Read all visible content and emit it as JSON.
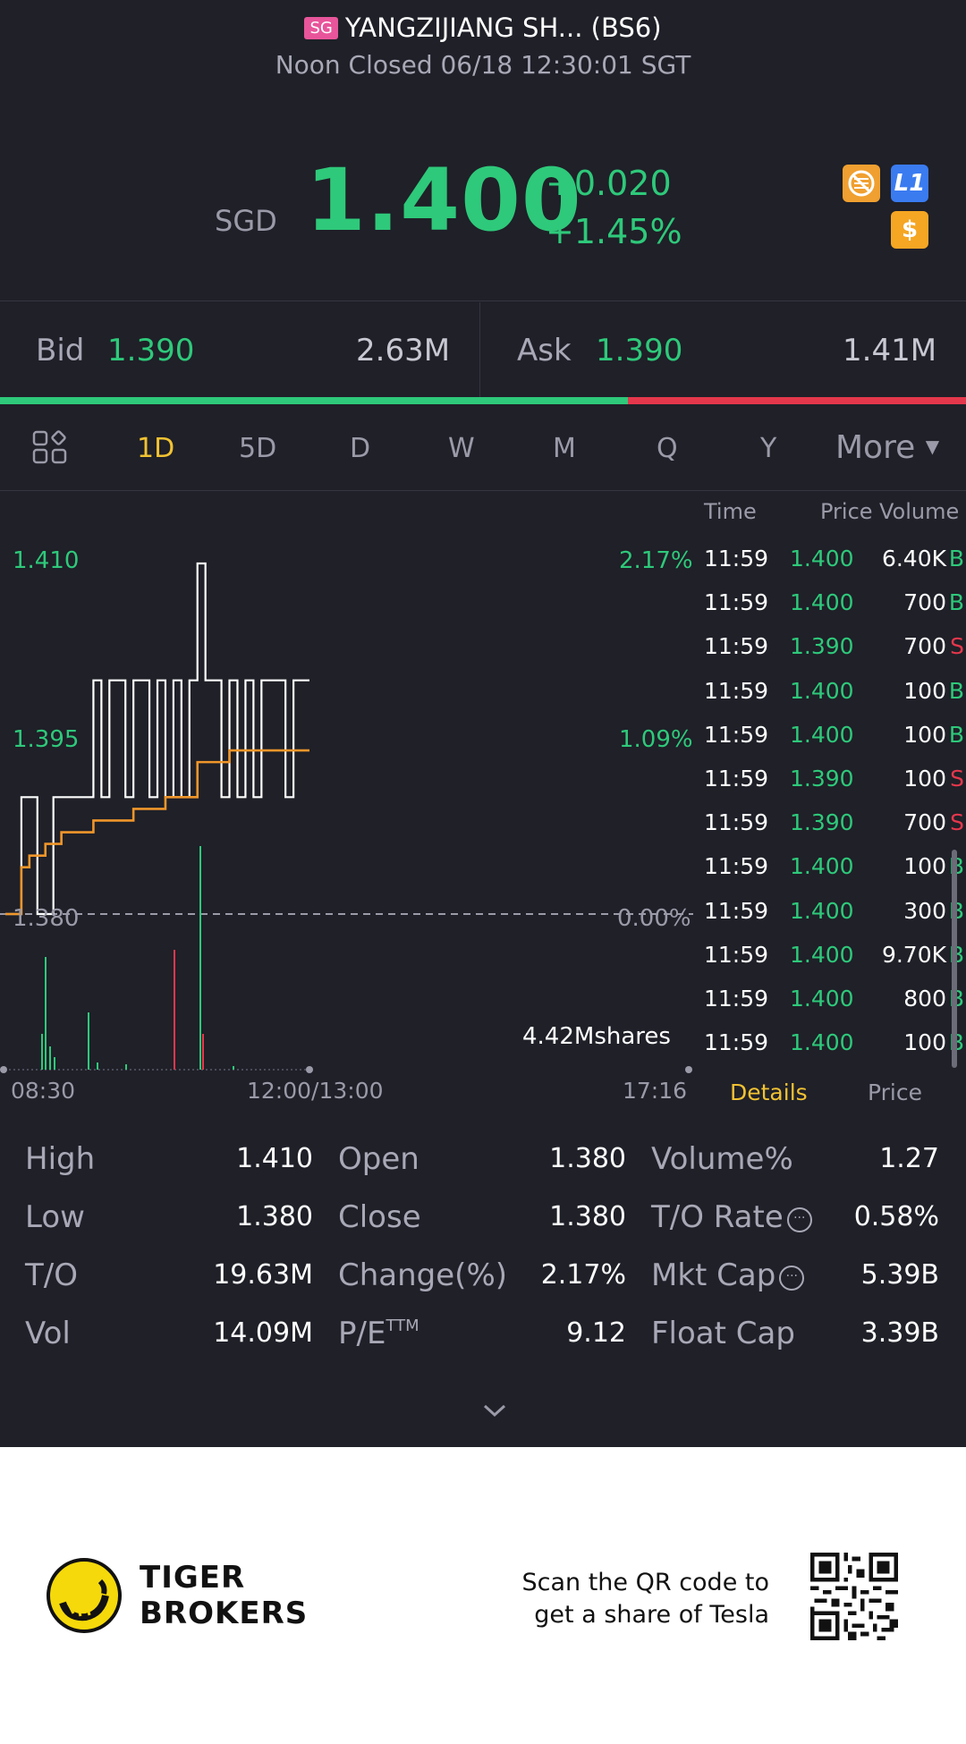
{
  "header": {
    "badge": "SG",
    "title": "YANGZIJIANG SH... (BS6)",
    "status": "Noon Closed 06/18 12:30:01 SGT",
    "currency": "SGD",
    "price": "1.400",
    "change": "+0.020",
    "change_pct": "+1.45%",
    "icons": [
      "no-trading-icon",
      "level1-icon",
      "dollar-icon"
    ],
    "l1_label": "L1",
    "dollar_label": "$"
  },
  "bidask": {
    "bid_label": "Bid",
    "bid_price": "1.390",
    "bid_volume": "2.63M",
    "ask_label": "Ask",
    "ask_price": "1.390",
    "ask_volume": "1.41M",
    "bid_ratio": 0.65
  },
  "tabs": {
    "items": [
      "1D",
      "5D",
      "D",
      "W",
      "M",
      "Q",
      "Y"
    ],
    "active": "1D",
    "more": "More"
  },
  "chart": {
    "y_labels": [
      "1.410",
      "1.395",
      "1.380"
    ],
    "pct_labels": [
      "2.17%",
      "1.09%",
      "0.00%"
    ],
    "volume_label": "4.42Mshares",
    "x_labels": [
      "08:30",
      "12:00/13:00",
      "17:16"
    ]
  },
  "chart_data": {
    "type": "line",
    "title": "",
    "ylim": [
      1.365,
      1.415
    ],
    "series": [
      {
        "values": [
          1.38,
          1.38,
          1.39,
          1.39,
          1.38,
          1.38,
          1.39,
          1.39,
          1.39,
          1.39,
          1.39,
          1.4,
          1.39,
          1.4,
          1.4,
          1.39,
          1.4,
          1.4,
          1.39,
          1.4,
          1.39,
          1.4,
          1.39,
          1.4,
          1.41,
          1.4,
          1.4,
          1.39,
          1.4,
          1.39,
          1.4,
          1.39,
          1.4,
          1.4,
          1.4,
          1.39,
          1.4,
          1.4,
          1.4
        ]
      },
      {
        "values": [
          1.38,
          1.38,
          1.384,
          1.385,
          1.385,
          1.386,
          1.386,
          1.387,
          1.387,
          1.387,
          1.387,
          1.388,
          1.388,
          1.388,
          1.388,
          1.388,
          1.389,
          1.389,
          1.389,
          1.389,
          1.39,
          1.39,
          1.39,
          1.39,
          1.393,
          1.393,
          1.393,
          1.393,
          1.394,
          1.394,
          1.394,
          1.394,
          1.394,
          1.394,
          1.394,
          1.394,
          1.394,
          1.394,
          1.394
        ]
      }
    ],
    "grid": false
  },
  "trades": {
    "headers": {
      "time": "Time",
      "price": "Price",
      "volume": "Volume"
    },
    "rows": [
      {
        "time": "11:59",
        "price": "1.400",
        "volume": "6.40K",
        "side": "B"
      },
      {
        "time": "11:59",
        "price": "1.400",
        "volume": "700",
        "side": "B"
      },
      {
        "time": "11:59",
        "price": "1.390",
        "volume": "700",
        "side": "S"
      },
      {
        "time": "11:59",
        "price": "1.400",
        "volume": "100",
        "side": "B"
      },
      {
        "time": "11:59",
        "price": "1.400",
        "volume": "100",
        "side": "B"
      },
      {
        "time": "11:59",
        "price": "1.390",
        "volume": "100",
        "side": "S"
      },
      {
        "time": "11:59",
        "price": "1.390",
        "volume": "700",
        "side": "S"
      },
      {
        "time": "11:59",
        "price": "1.400",
        "volume": "100",
        "side": "B"
      },
      {
        "time": "11:59",
        "price": "1.400",
        "volume": "300",
        "side": "B"
      },
      {
        "time": "11:59",
        "price": "1.400",
        "volume": "9.70K",
        "side": "B"
      },
      {
        "time": "11:59",
        "price": "1.400",
        "volume": "800",
        "side": "B"
      },
      {
        "time": "11:59",
        "price": "1.400",
        "volume": "100",
        "side": "B"
      }
    ],
    "tab_details": "Details",
    "tab_price": "Price"
  },
  "stats": [
    [
      {
        "label": "High",
        "value": "1.410"
      },
      {
        "label": "Open",
        "value": "1.380"
      },
      {
        "label": "Volume%",
        "value": "1.27"
      }
    ],
    [
      {
        "label": "Low",
        "value": "1.380"
      },
      {
        "label": "Close",
        "value": "1.380"
      },
      {
        "label": "T/O Rate",
        "value": "0.58%"
      }
    ],
    [
      {
        "label": "T/O",
        "value": "19.63M"
      },
      {
        "label": "Change(%)",
        "value": "2.17%"
      },
      {
        "label": "Mkt Cap",
        "value": "5.39B"
      }
    ],
    [
      {
        "label": "Vol",
        "value": "14.09M"
      },
      {
        "label": "P/E",
        "value": "9.12"
      },
      {
        "label": "Float Cap",
        "value": "3.39B"
      }
    ]
  ],
  "pe_suffix": "TTM",
  "footer": {
    "brand_line1": "TIGER",
    "brand_line2": "BROKERS",
    "promo_line1": "Scan the QR code to",
    "promo_line2": "get a share of Tesla"
  },
  "colors": {
    "up": "#2ec97a",
    "down": "#e5374c",
    "accent": "#f1c232",
    "background": "#1f2028"
  }
}
